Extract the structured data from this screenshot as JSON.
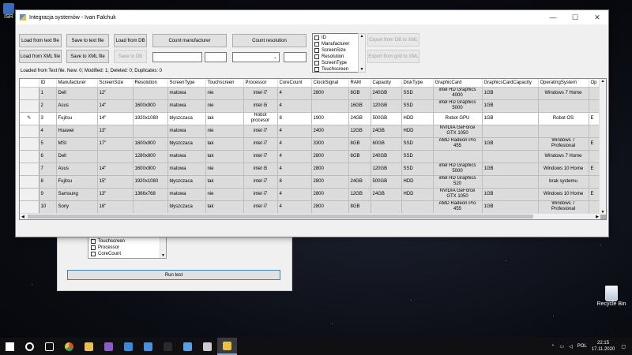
{
  "desktop": {
    "top_left_label": "ISR",
    "recycle_bin_label": "Recycle Bin"
  },
  "back_window": {
    "list_items": [
      {
        "label": "Touchscreen",
        "checked": false
      },
      {
        "label": "Processor",
        "checked": false
      },
      {
        "label": "CoreCount",
        "checked": false
      }
    ],
    "run_button": "Run test"
  },
  "window": {
    "title": "Integracja systemów - Ivan Falchuk",
    "controls": {
      "minimize": "—",
      "maximize": "☐",
      "close": "✕"
    }
  },
  "toolbar": {
    "load_text": "Load from text file",
    "save_text": "Save to text file",
    "load_db": "Load from DB",
    "count_manufacturer": "Count manufacturer",
    "count_resolution": "Count resolution",
    "export_db_xml": "Export from DB to XML",
    "load_xml": "Load from XML file",
    "save_xml": "Save to XML file",
    "save_db": "Save to DB",
    "export_grid_xml": "Export from grid to XML",
    "combo_value": ""
  },
  "column_filter": [
    {
      "label": "ID",
      "checked": false
    },
    {
      "label": "Manufacturer",
      "checked": false
    },
    {
      "label": "ScreenSize",
      "checked": false
    },
    {
      "label": "Resolution",
      "checked": false
    },
    {
      "label": "ScreenType",
      "checked": false
    },
    {
      "label": "Touchscreen",
      "checked": false
    }
  ],
  "status": "Loaded from Text file. New: 0; Modified: 1; Deleted: 0; Duplicates: 0",
  "grid": {
    "columns": [
      "ID",
      "Manufacturer",
      "ScreenSize",
      "Resolution",
      "ScreenType",
      "Touchscreen",
      "Processor",
      "CoreCount",
      "ClockSignal",
      "RAM",
      "Capacity",
      "DiskType",
      "GraphicCard",
      "GraphicsCardCapacity",
      "OperatingSystem",
      "Op"
    ],
    "rows": [
      {
        "marker": "",
        "cells": [
          "1",
          "Dell",
          "12\"",
          "",
          "matowa",
          "nie",
          "intel i7",
          "4",
          "2800",
          "8GB",
          "240GB",
          "SSD",
          "intel HD Graphics 4000",
          "1GB",
          "Windows 7 Home",
          ""
        ]
      },
      {
        "marker": "",
        "cells": [
          "2",
          "Asus",
          "14\"",
          "1600x900",
          "matowa",
          "nie",
          "intel i5",
          "4",
          "",
          "16GB",
          "120GB",
          "SSD",
          "intel HD Graphics 5000",
          "1GB",
          "",
          ""
        ]
      },
      {
        "marker": "✎",
        "cells": [
          "3",
          "Fujitsu",
          "14\"",
          "1920x1080",
          "blyszczaca",
          "tak",
          "Robot procesor",
          "8",
          "1900",
          "24GB",
          "500GB",
          "HDD",
          "Robot GPU",
          "1GB",
          "Robot OS",
          "E"
        ]
      },
      {
        "marker": "",
        "cells": [
          "4",
          "Huawei",
          "13\"",
          "",
          "matowa",
          "nie",
          "intel i7",
          "4",
          "2400",
          "12GB",
          "24GB",
          "HDD",
          "NVIDIA GeForce GTX 1050",
          "",
          "",
          ""
        ]
      },
      {
        "marker": "",
        "cells": [
          "5",
          "MSI",
          "17\"",
          "1600x900",
          "blyszczaca",
          "tak",
          "intel i7",
          "4",
          "3300",
          "8GB",
          "60GB",
          "SSD",
          "AMD Radeon Pro 455",
          "1GB",
          "Windows 7 Profesional",
          "E"
        ]
      },
      {
        "marker": "",
        "cells": [
          "6",
          "Dell",
          "",
          "1280x800",
          "matowa",
          "tak",
          "intel i7",
          "4",
          "2800",
          "8GB",
          "240GB",
          "SSD",
          "",
          "",
          "Windows 7 Home",
          ""
        ]
      },
      {
        "marker": "",
        "cells": [
          "7",
          "Asus",
          "14\"",
          "1600x900",
          "matowa",
          "nie",
          "intel i5",
          "4",
          "2800",
          "",
          "120GB",
          "SSD",
          "intel HD Graphics 5000",
          "1GB",
          "Windows 10 Home",
          "E"
        ]
      },
      {
        "marker": "",
        "cells": [
          "8",
          "Fujitsu",
          "15\"",
          "1920x1080",
          "blyszczaca",
          "tak",
          "intel i7",
          "8",
          "2800",
          "24GB",
          "500GB",
          "HDD",
          "intel HD Graphics 520",
          "",
          "brak systemu",
          ""
        ]
      },
      {
        "marker": "",
        "cells": [
          "9",
          "Samsung",
          "13\"",
          "1366x768",
          "matowa",
          "nie",
          "intel i7",
          "4",
          "2800",
          "12GB",
          "24GB",
          "HDD",
          "NVIDIA GeForce GTX 1050",
          "1GB",
          "Windows 10 Home",
          "E"
        ]
      },
      {
        "marker": "",
        "cells": [
          "10",
          "Sony",
          "16\"",
          "",
          "blyszczaca",
          "tak",
          "intel i7",
          "4",
          "2800",
          "8GB",
          "",
          "",
          "AMD Radeon Pro 455",
          "1GB",
          "Windows 7 Profesional",
          ""
        ]
      }
    ]
  },
  "taskbar": {
    "icons": [
      {
        "name": "start-icon",
        "color": "#ffffff"
      },
      {
        "name": "search-icon",
        "color": "#ffffff"
      },
      {
        "name": "task-view-icon",
        "color": "#ffffff"
      },
      {
        "name": "chrome-icon",
        "color": "#e8b020"
      },
      {
        "name": "file-explorer-icon",
        "color": "#e8c050"
      },
      {
        "name": "visual-studio-icon",
        "color": "#8a5cc8"
      },
      {
        "name": "sql-server-icon",
        "color": "#3a8ad8"
      },
      {
        "name": "snipping-tool-icon",
        "color": "#4a90e0"
      },
      {
        "name": "terminal-icon",
        "color": "#2a2a2a"
      },
      {
        "name": "notepad-icon",
        "color": "#5aa0e0"
      },
      {
        "name": "settings-icon",
        "color": "#cccccc"
      },
      {
        "name": "app-window-icon",
        "color": "#e8c040"
      }
    ],
    "tray": {
      "language": "POL",
      "time": "22:15",
      "date": "17.11.2020"
    }
  }
}
